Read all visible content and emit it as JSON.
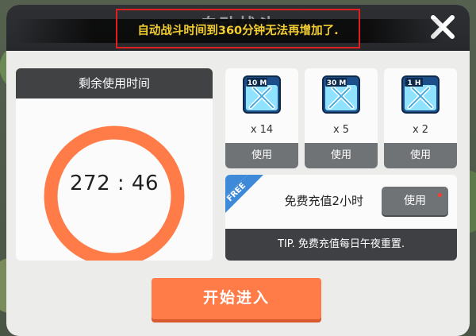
{
  "dialog": {
    "title": "自动战斗",
    "toast": "自动战斗时间到360分钟无法再增加了.",
    "close_icon": "close-icon"
  },
  "timer": {
    "header": "剩余使用时间",
    "value": "272 : 46",
    "ring_color": "#ff7b48"
  },
  "items": [
    {
      "badge": "10 M",
      "quantity": "x 14",
      "button": "使用"
    },
    {
      "badge": "30 M",
      "quantity": "x 5",
      "button": "使用"
    },
    {
      "badge": "1 H",
      "quantity": "x 2",
      "button": "使用"
    }
  ],
  "free_recharge": {
    "ribbon": "FREE",
    "label": "免费充值2小时",
    "button": "使用",
    "tip": "TIP. 免费充值每日午夜重置."
  },
  "start_button": "开始进入",
  "colors": {
    "accent": "#ff7b48",
    "toast_text": "#f3cd31",
    "highlight_box": "#e02020",
    "ribbon": "#3e8ad8"
  }
}
